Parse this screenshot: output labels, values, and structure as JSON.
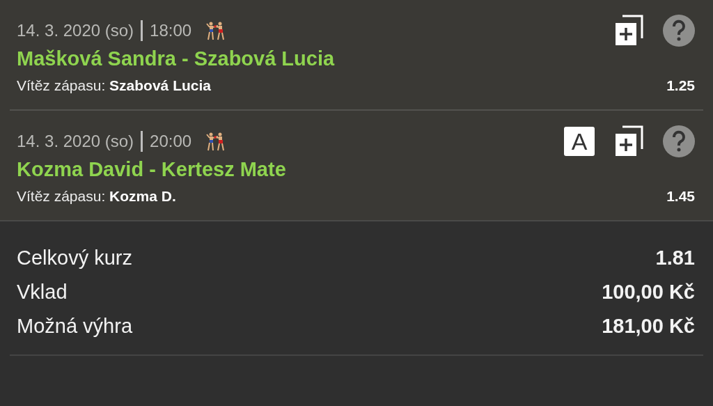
{
  "events": [
    {
      "date": "14. 3. 2020 (so)",
      "time": "18:00",
      "match": "Mašková Sandra - Szabová Lucia",
      "bet_label": "Vítěz zápasu:",
      "bet_pick": "Szabová Lucia",
      "odds": "1.25"
    },
    {
      "date": "14. 3. 2020 (so)",
      "time": "20:00",
      "badge": "A",
      "match": "Kozma David - Kertesz Mate",
      "bet_label": "Vítěz zápasu:",
      "bet_pick": "Kozma D.",
      "odds": "1.45"
    }
  ],
  "summary": [
    {
      "label": "Celkový kurz",
      "value": "1.81"
    },
    {
      "label": "Vklad",
      "value": "100,00 Kč"
    },
    {
      "label": "Možná výhra",
      "value": "181,00 Kč"
    }
  ]
}
